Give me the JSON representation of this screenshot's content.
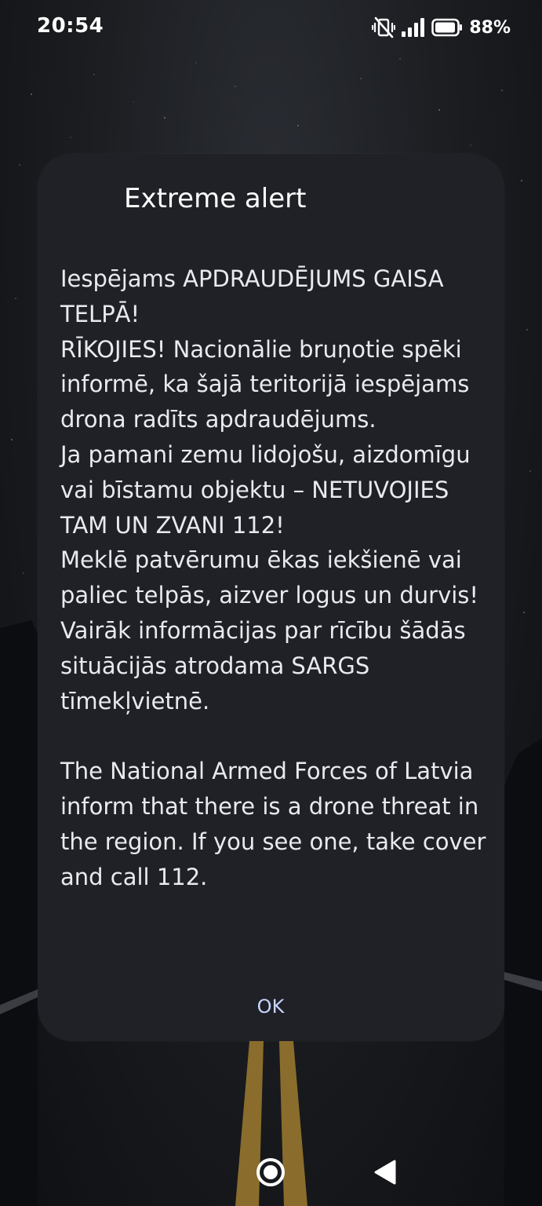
{
  "status_bar": {
    "time": "20:54",
    "icons": [
      "vibrate-off-icon",
      "signal-icon",
      "battery-icon"
    ],
    "battery_percent": "88%"
  },
  "alert": {
    "title": "Extreme alert",
    "body_lv": "Iespējams APDRAUDĒJUMS GAISA TELPĀ!\nRĪKOJIES! Nacionālie bruņotie spēki informē, ka šajā teritorijā iespējams drona radīts apdraudējums.\nJa pamani zemu lidojošu, aizdomīgu vai bīstamu objektu – NETUVOJIES TAM UN ZVANI 112!\nMeklē patvērumu ēkas iekšienē vai paliec telpās, aizver logus un durvis!\nVairāk informācijas par rīcību šādās situācijās atrodama SARGS tīmekļvietnē.",
    "body_en": "The National Armed Forces of Latvia inform that there is a drone threat in the region. If you see one, take cover and call 112.",
    "ok_label": "OK",
    "accent_color": "#c6d4ff"
  },
  "nav_bar": {
    "icons": [
      "home-icon",
      "back-icon"
    ]
  }
}
